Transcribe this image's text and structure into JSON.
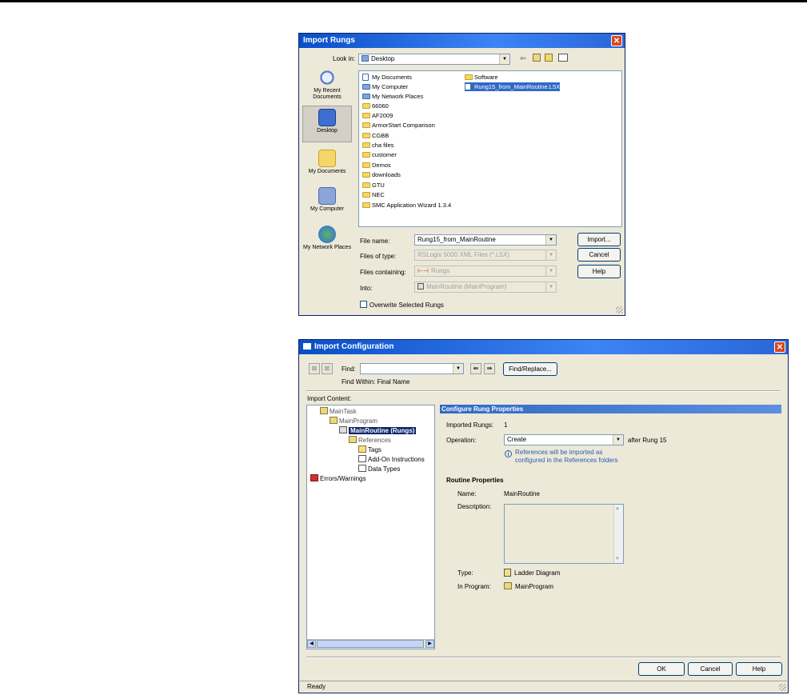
{
  "rungs_dialog": {
    "title": "Import Rungs",
    "close": "✕",
    "look_in_label": "Look in:",
    "look_in_value": "Desktop",
    "places": [
      {
        "label": "My Recent Documents"
      },
      {
        "label": "Desktop"
      },
      {
        "label": "My Documents"
      },
      {
        "label": "My Computer"
      },
      {
        "label": "My Network Places"
      }
    ],
    "files": [
      "My Documents",
      "My Computer",
      "My Network Places",
      "66060",
      "AF2009",
      "ArmorStart Comparison",
      "CGBB",
      "cha files",
      "customer",
      "Demos",
      "downloads",
      "GTU",
      "NEC",
      "SMC Application Wizard 1.3.4"
    ],
    "files_col2": [
      "Software",
      "Rung15_from_MainRoutine.L5X"
    ],
    "file_name_label": "File name:",
    "file_name_value": "Rung15_from_MainRoutine",
    "files_of_type_label": "Files of type:",
    "files_of_type_value": "RSLogix 5000 XML Files (*.L5X)",
    "files_containing_label": "Files containing:",
    "files_containing_value": "Rungs",
    "into_label": "Into:",
    "into_value": "MainRoutine (MainProgram)",
    "overwrite_label": "Overwrite Selected Rungs",
    "import_btn": "Import...",
    "cancel_btn": "Cancel",
    "help_btn": "Help"
  },
  "config_dialog": {
    "title": "Import Configuration",
    "find_label": "Find:",
    "find_value": "",
    "find_within": "Find Within: Final Name",
    "find_replace_btn": "Find/Replace...",
    "import_content_label": "Import Content:",
    "tree": {
      "task": "MainTask",
      "program": "MainProgram",
      "routine": "MainRoutine (Rungs)",
      "references": "References",
      "tags": "Tags",
      "aoi": "Add-On Instructions",
      "data_types": "Data Types",
      "errors": "Errors/Warnings"
    },
    "panel_title": "Configure Rung Properties",
    "imported_rungs_label": "Imported Rungs:",
    "imported_rungs_value": "1",
    "operation_label": "Operation:",
    "operation_value": "Create",
    "after_rung": "after Rung 15",
    "info_line1": "References will be imported as",
    "info_line2": "configured in the References folders",
    "routine_props_heading": "Routine Properties",
    "name_label": "Name:",
    "name_value": "MainRoutine",
    "description_label": "Description:",
    "type_label": "Type:",
    "type_value": "Ladder Diagram",
    "in_program_label": "In Program:",
    "in_program_value": "MainProgram",
    "ok_btn": "OK",
    "cancel_btn": "Cancel",
    "help_btn": "Help",
    "status": "Ready"
  }
}
